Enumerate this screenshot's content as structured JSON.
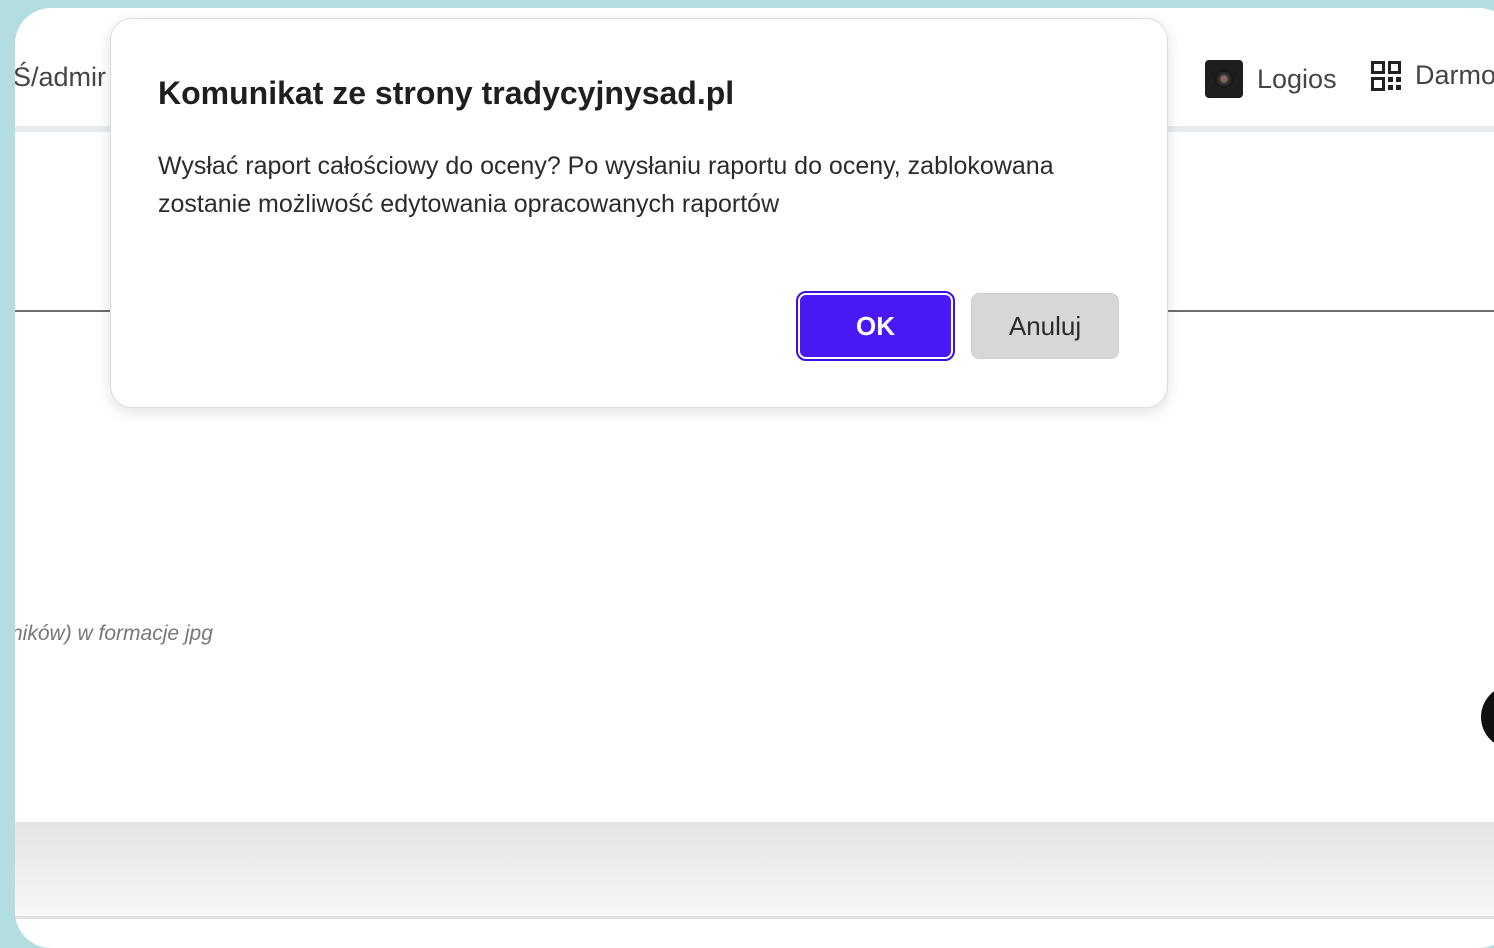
{
  "browser": {
    "url_fragment": "Ś/admir",
    "bookmarks": [
      {
        "label": "Logios",
        "icon": "logios-icon"
      },
      {
        "label": "Darmo",
        "icon": "qr-code-icon"
      }
    ]
  },
  "page": {
    "hint_text": "ników) w formacje jpg"
  },
  "dialog": {
    "title": "Komunikat ze strony tradycyjnysad.pl",
    "message": "Wysłać raport całościowy do oceny? Po wysłaniu raportu do oceny, zablokowana zostanie możliwość edytowania opracowanych raportów",
    "ok_label": "OK",
    "cancel_label": "Anuluj"
  },
  "colors": {
    "backdrop": "#b4dde1",
    "ok_button": "#4a19f5",
    "cancel_button": "#d7d7d9"
  }
}
